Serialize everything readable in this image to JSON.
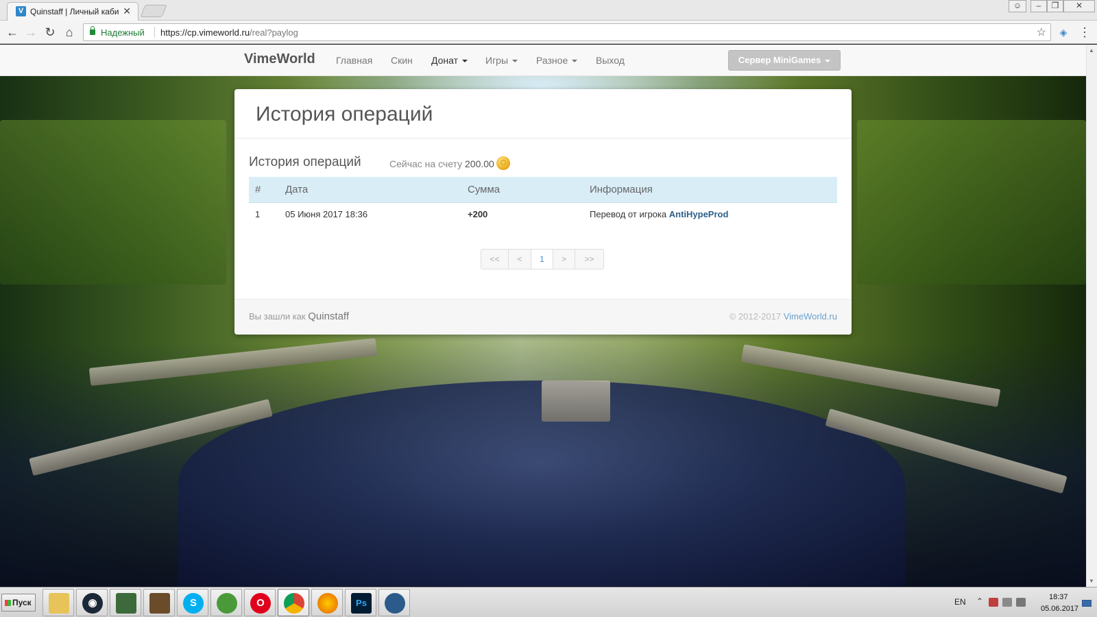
{
  "browser": {
    "tab_title": "Quinstaff | Личный каби",
    "favicon_letter": "V",
    "secure_label": "Надежный",
    "url_host": "https://cp.vimeworld.ru",
    "url_path": "/real?paylog"
  },
  "site": {
    "brand": "VimeWorld",
    "nav": {
      "home": "Главная",
      "skin": "Скин",
      "donate": "Донат",
      "games": "Игры",
      "misc": "Разное",
      "logout": "Выход"
    },
    "server_button": "Сервер MiniGames"
  },
  "page": {
    "title": "История операций",
    "section_title": "История операций",
    "balance_prefix": "Сейчас на счету",
    "balance_value": "200.00",
    "table": {
      "headers": [
        "#",
        "Дата",
        "Сумма",
        "Информация"
      ],
      "rows": [
        {
          "num": "1",
          "date": "05 Июня 2017 18:36",
          "amount": "+200",
          "info_prefix": "Перевод от игрока",
          "info_player": "AntiHypeProd"
        }
      ]
    },
    "pagination": {
      "first": "<<",
      "prev": "<",
      "current": "1",
      "next": ">",
      "last": ">>"
    },
    "footer": {
      "logged_in_prefix": "Вы зашли как",
      "username": "Quinstaff",
      "copyright_prefix": "© 2012-2017",
      "copyright_site": "VimeWorld.ru"
    }
  },
  "taskbar": {
    "start_label": "Пуск",
    "lang": "EN",
    "time": "18:37",
    "date": "05.06.2017"
  },
  "colors": {
    "table_header_bg": "#d9edf7",
    "positive_amount": "#3c763d",
    "link": "#2c5f8a",
    "secure_green": "#1e7d35"
  }
}
